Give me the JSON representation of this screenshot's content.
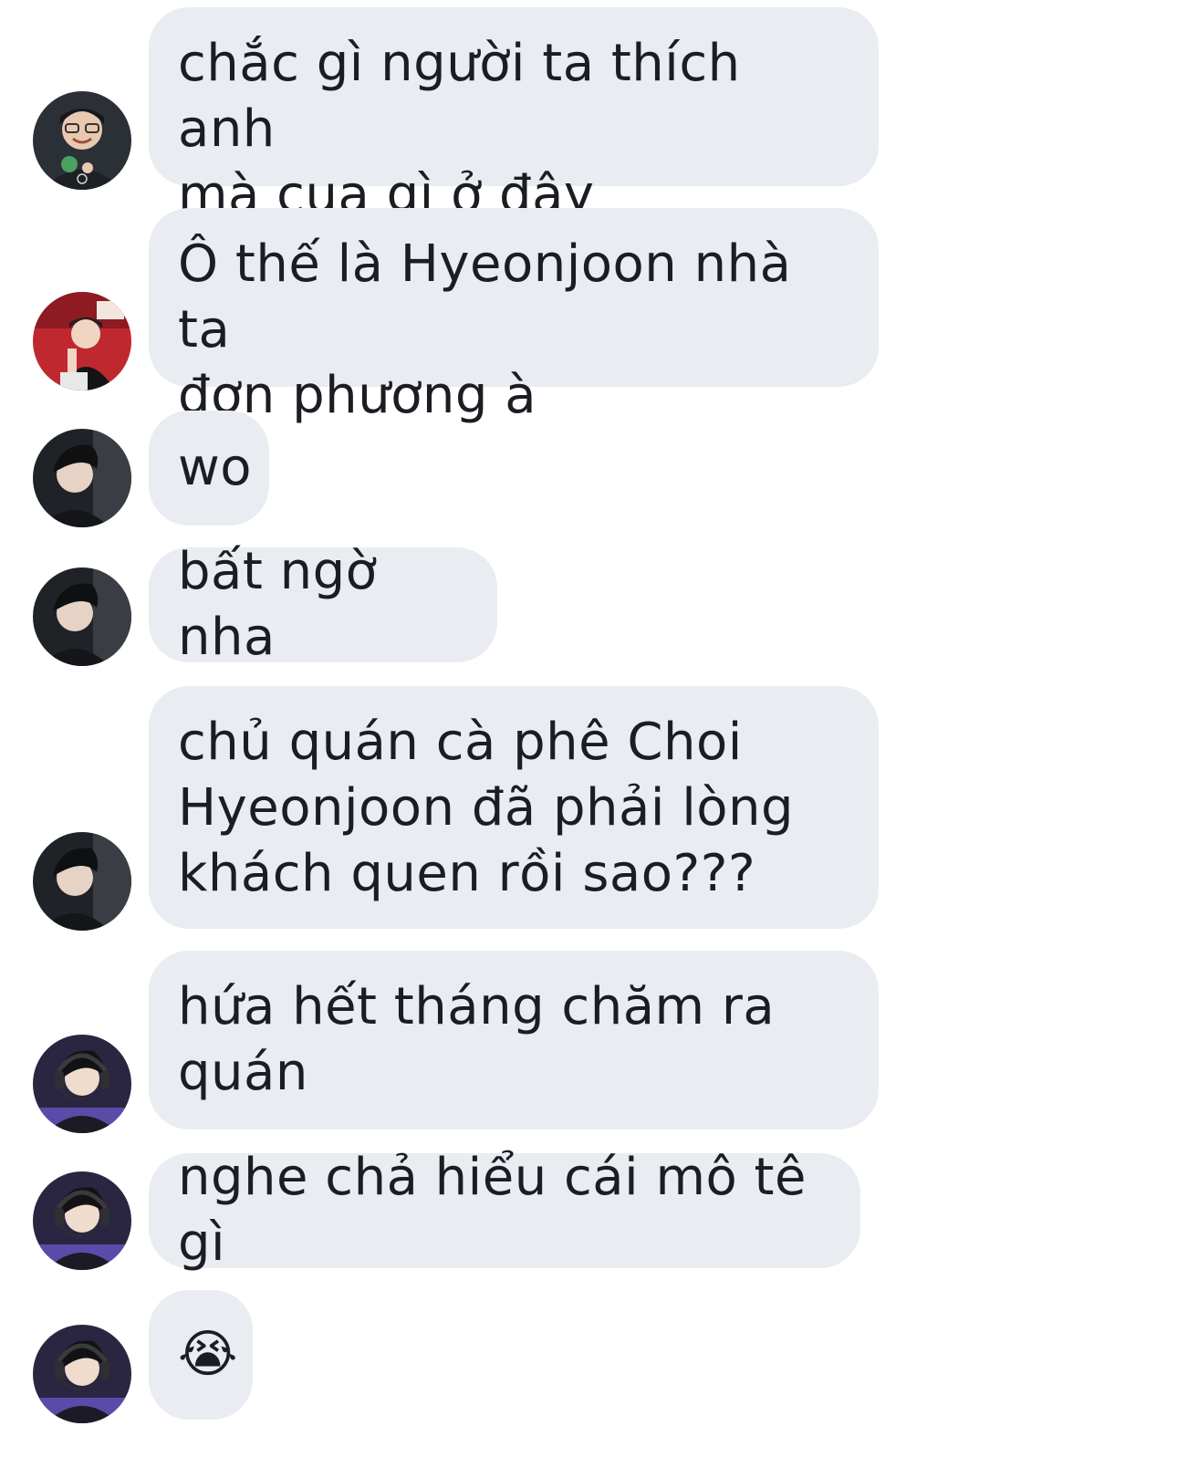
{
  "conversation": {
    "messages": [
      {
        "text": "chắc gì người ta thích anh\nmà cua gì ở đây",
        "avatar": "avatar-a"
      },
      {
        "text": "Ô thế là Hyeonjoon nhà ta\nđơn phương à",
        "avatar": "avatar-b"
      },
      {
        "text": "wo",
        "avatar": "avatar-c"
      },
      {
        "text": "bất ngờ nha",
        "avatar": "avatar-c"
      },
      {
        "text": "chủ quán cà phê Choi\nHyeonjoon đã phải lòng\nkhách quen rồi sao???",
        "avatar": "avatar-c"
      },
      {
        "text": "hứa hết tháng chăm ra\nquán",
        "avatar": "avatar-d"
      },
      {
        "text": "nghe chả hiểu cái mô tê gì",
        "avatar": "avatar-d"
      },
      {
        "text": "😭",
        "avatar": "avatar-d"
      }
    ]
  },
  "colors": {
    "bubble": "#e9ecf0",
    "text": "#1b1d22",
    "background": "#ffffff"
  }
}
